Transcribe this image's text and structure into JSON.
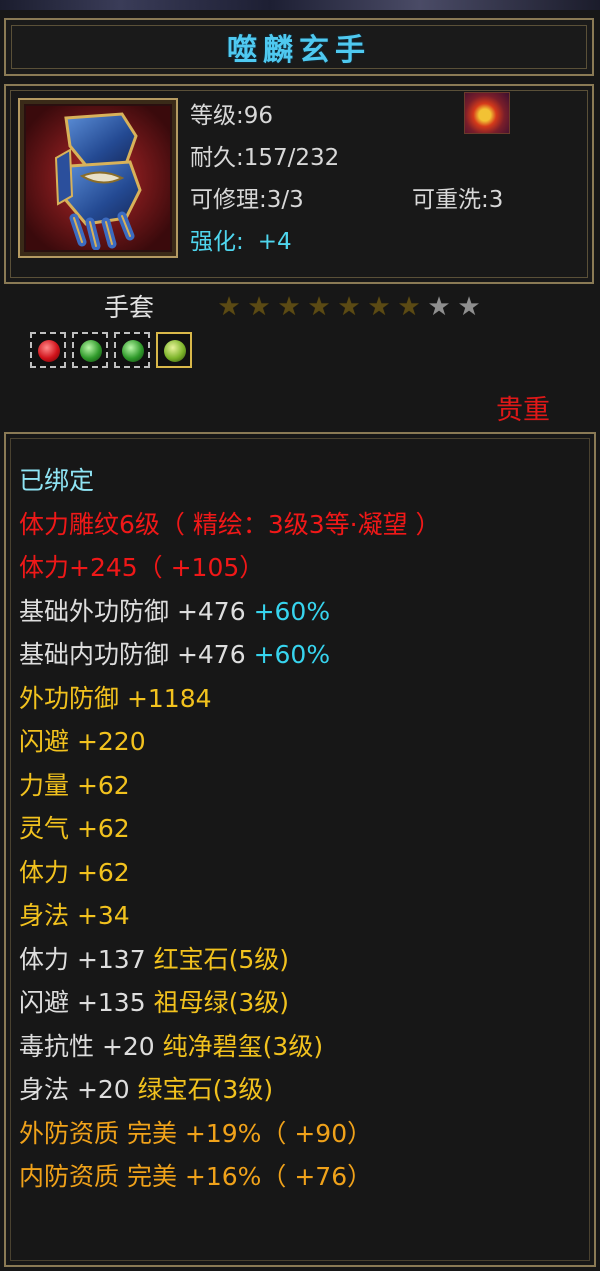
{
  "item": {
    "name": "噬麟玄手",
    "level_label": "等级:96",
    "durability_label": "耐久:157/232",
    "repairable_label": "可修理:3/3",
    "rewash_label": "可重洗:3",
    "enhance_label": "强化:",
    "enhance_value": "+4",
    "category": "手套",
    "stars_filled": 7,
    "stars_total": 9,
    "rarity": "贵重",
    "gems": [
      "red-gem",
      "green-gem",
      "green-gem",
      "jade-gem"
    ]
  },
  "stats": {
    "bound": "已绑定",
    "carve": "体力雕纹6级（ 精绘：3级3等·凝望 ）",
    "stamina_main": "体力+245（ +105）",
    "base_ext_def": "基础外功防御 +476",
    "base_ext_def_pct": "+60%",
    "base_int_def": "基础内功防御 +476",
    "base_int_def_pct": "+60%",
    "ext_def": "外功防御 +1184",
    "dodge": "闪避 +220",
    "strength": "力量 +62",
    "spirit": "灵气 +62",
    "stamina": "体力 +62",
    "agility": "身法 +34",
    "gem1_stat": "体力 +137",
    "gem1_name": "红宝石(5级)",
    "gem2_stat": "闪避 +135",
    "gem2_name": "祖母绿(3级)",
    "gem3_stat": "毒抗性 +20",
    "gem3_name": "纯净碧玺(3级)",
    "gem4_stat": "身法 +20",
    "gem4_name": "绿宝石(3级)",
    "qual1": "外防资质 完美 +19%（ +90）",
    "qual2": "内防资质 完美 +16%（ +76）"
  }
}
